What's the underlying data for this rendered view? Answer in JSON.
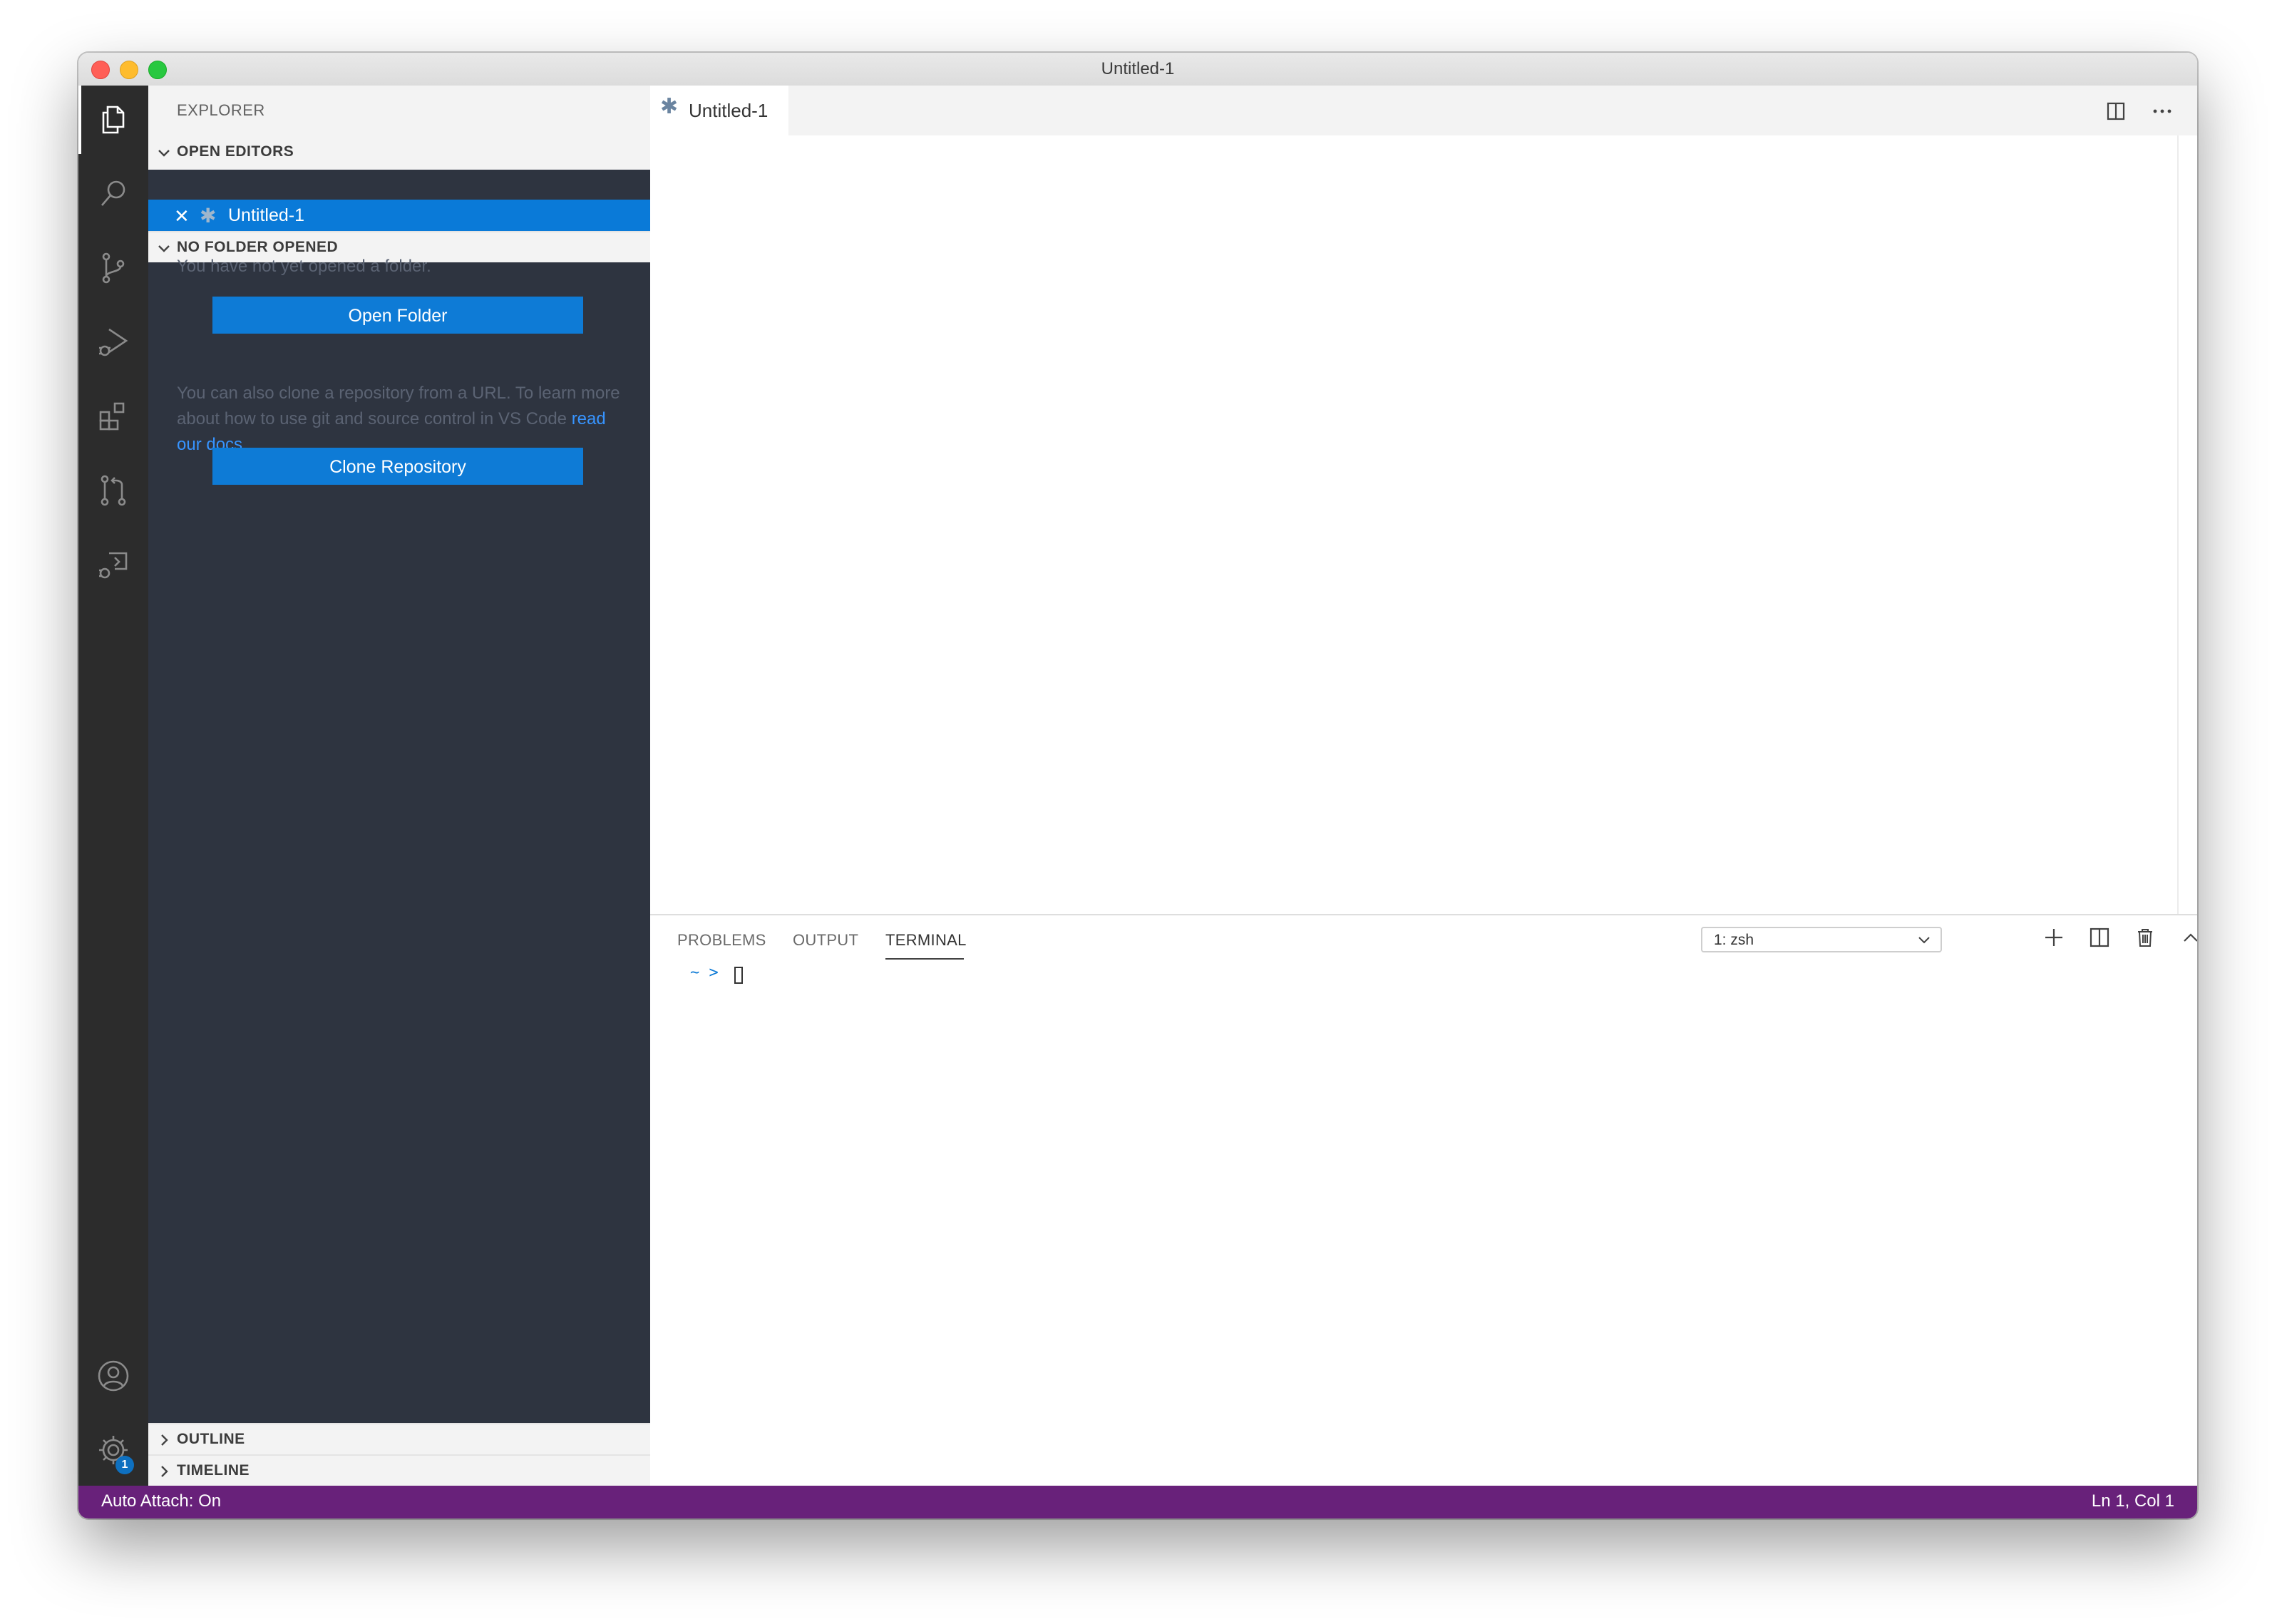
{
  "window": {
    "title": "Untitled-1"
  },
  "activity_bar": {
    "icons": [
      "explorer-icon",
      "search-icon",
      "source-control-icon",
      "run-debug-icon",
      "extensions-icon",
      "pull-requests-icon",
      "remote-explorer-icon",
      "accounts-icon",
      "manage-gear-icon"
    ],
    "settings_badge": "1"
  },
  "sidebar": {
    "title": "EXPLORER",
    "open_editors": {
      "header": "OPEN EDITORS",
      "items": [
        {
          "close": "✕",
          "dirty": "✱",
          "name": "Untitled-1"
        }
      ]
    },
    "no_folder": {
      "header": "NO FOLDER OPENED",
      "message": "You have not yet opened a folder.",
      "open_folder_label": "Open Folder",
      "clone_message_prefix": "You can also clone a repository from a URL. To learn more about how to use git and source control in VS Code ",
      "clone_message_link": "read our docs",
      "clone_message_suffix": ".",
      "clone_button_label": "Clone Repository"
    },
    "outline_header": "OUTLINE",
    "timeline_header": "TIMELINE"
  },
  "editor": {
    "tabs": [
      {
        "dirty": "✱",
        "label": "Untitled-1"
      }
    ]
  },
  "panel": {
    "tabs": [
      "PROBLEMS",
      "OUTPUT",
      "TERMINAL"
    ],
    "active_tab": "TERMINAL",
    "terminal_select": "1: zsh",
    "prompt": "~ >"
  },
  "status_bar": {
    "left": "Auto Attach: On",
    "right": "Ln 1, Col 1",
    "color": "#68217a"
  },
  "colors": {
    "accent": "#0e7bd6",
    "sidebar_bg": "#2e3440",
    "activity_bg": "#2c2c2c"
  }
}
